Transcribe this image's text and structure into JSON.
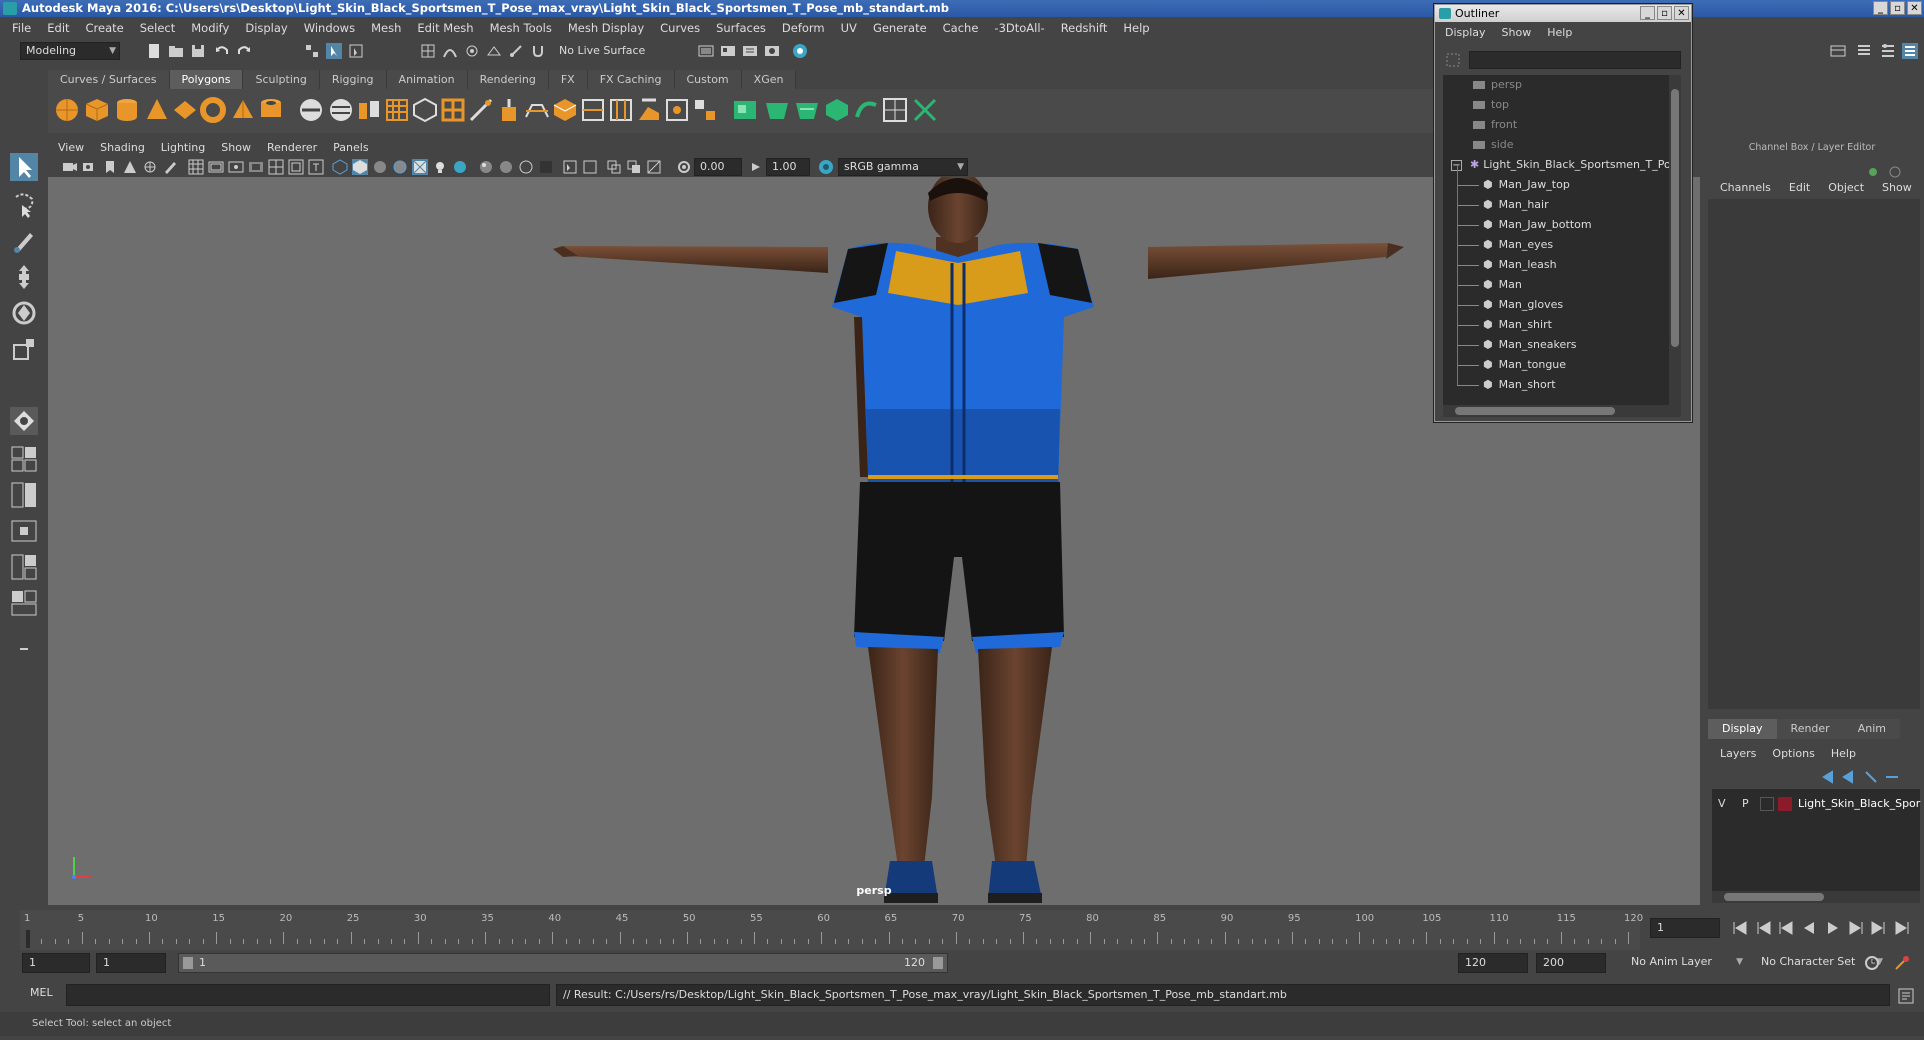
{
  "window": {
    "title": "Autodesk Maya 2016: C:\\Users\\rs\\Desktop\\Light_Skin_Black_Sportsmen_T_Pose_max_vray\\Light_Skin_Black_Sportsmen_T_Pose_mb_standart.mb"
  },
  "menubar": [
    "File",
    "Edit",
    "Create",
    "Select",
    "Modify",
    "Display",
    "Windows",
    "Mesh",
    "Edit Mesh",
    "Mesh Tools",
    "Mesh Display",
    "Curves",
    "Surfaces",
    "Deform",
    "UV",
    "Generate",
    "Cache",
    "-3DtoAll-",
    "Redshift",
    "Help"
  ],
  "statusline": {
    "mode": "Modeling",
    "live_surface": "No Live Surface"
  },
  "shelf": {
    "tabs": [
      "Curves / Surfaces",
      "Polygons",
      "Sculpting",
      "Rigging",
      "Animation",
      "Rendering",
      "FX",
      "FX Caching",
      "Custom",
      "XGen"
    ],
    "active_tab": "Polygons"
  },
  "viewport": {
    "menu": [
      "View",
      "Shading",
      "Lighting",
      "Show",
      "Renderer",
      "Panels"
    ],
    "exposure": "0.00",
    "gamma": "1.00",
    "color_space": "sRGB gamma",
    "camera_label": "persp"
  },
  "outliner": {
    "title": "Outliner",
    "menu": [
      "Display",
      "Show",
      "Help"
    ],
    "cameras": [
      "persp",
      "top",
      "front",
      "side"
    ],
    "root": "Light_Skin_Black_Sportsmen_T_Pose",
    "children": [
      "Man_Jaw_top",
      "Man_hair",
      "Man_Jaw_bottom",
      "Man_eyes",
      "Man_leash",
      "Man",
      "Man_gloves",
      "Man_shirt",
      "Man_sneakers",
      "Man_tongue",
      "Man_short"
    ]
  },
  "channelbox": {
    "header": "Channel Box / Layer Editor",
    "menu": [
      "Channels",
      "Edit",
      "Object",
      "Show"
    ],
    "layer_tabs": [
      "Display",
      "Render",
      "Anim"
    ],
    "active_layer_tab": "Display",
    "layer_menu": [
      "Layers",
      "Options",
      "Help"
    ],
    "layer": {
      "v": "V",
      "p": "P",
      "name": "Light_Skin_Black_Spor",
      "color": "#8b1a2b"
    }
  },
  "timeline": {
    "ticks": [
      "1",
      "5",
      "10",
      "15",
      "20",
      "25",
      "30",
      "35",
      "40",
      "45",
      "50",
      "55",
      "60",
      "65",
      "70",
      "75",
      "80",
      "85",
      "90",
      "95",
      "100",
      "105",
      "110",
      "115",
      "120"
    ],
    "current_frame": "1"
  },
  "range": {
    "start": "1",
    "start_inner": "1",
    "slider_start": "1",
    "slider_end": "120",
    "end_inner": "120",
    "end": "200",
    "anim_layer": "No Anim Layer",
    "character_set": "No Character Set"
  },
  "commandline": {
    "lang": "MEL",
    "result": "// Result: C:/Users/rs/Desktop/Light_Skin_Black_Sportsmen_T_Pose_max_vray/Light_Skin_Black_Sportsmen_T_Pose_mb_standart.mb"
  },
  "helpline": "Select Tool: select an object",
  "colors": {
    "accent": "#5285a6",
    "panel": "#444444",
    "viewport_bg": "#6e6e6e",
    "shirt_blue": "#1e6ad6",
    "shirt_yellow": "#d89b1a"
  }
}
